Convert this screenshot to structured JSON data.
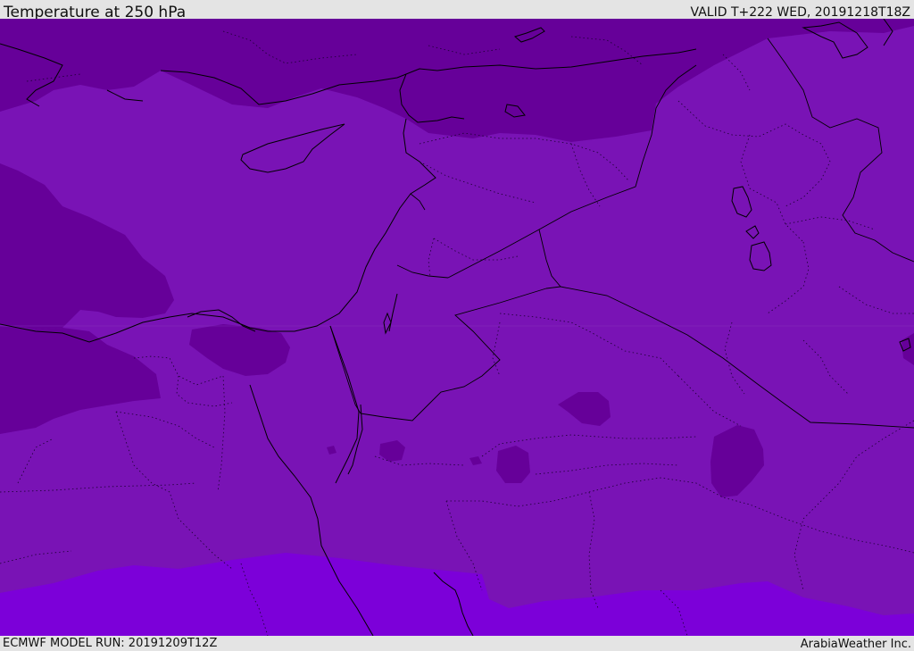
{
  "header": {
    "title": "Temperature at 250 hPa",
    "valid": "VALID T+222 WED, 20191218T18Z"
  },
  "footer": {
    "model_run": "ECMWF MODEL RUN: 20191209T12Z",
    "credit": "ArabiaWeather Inc."
  },
  "map": {
    "region": "Eastern Mediterranean / Middle East",
    "colors": {
      "cold_band": "#660099",
      "mid_band": "#7913b5",
      "warm_band": "#7c00d9",
      "coastline": "#000000"
    }
  }
}
